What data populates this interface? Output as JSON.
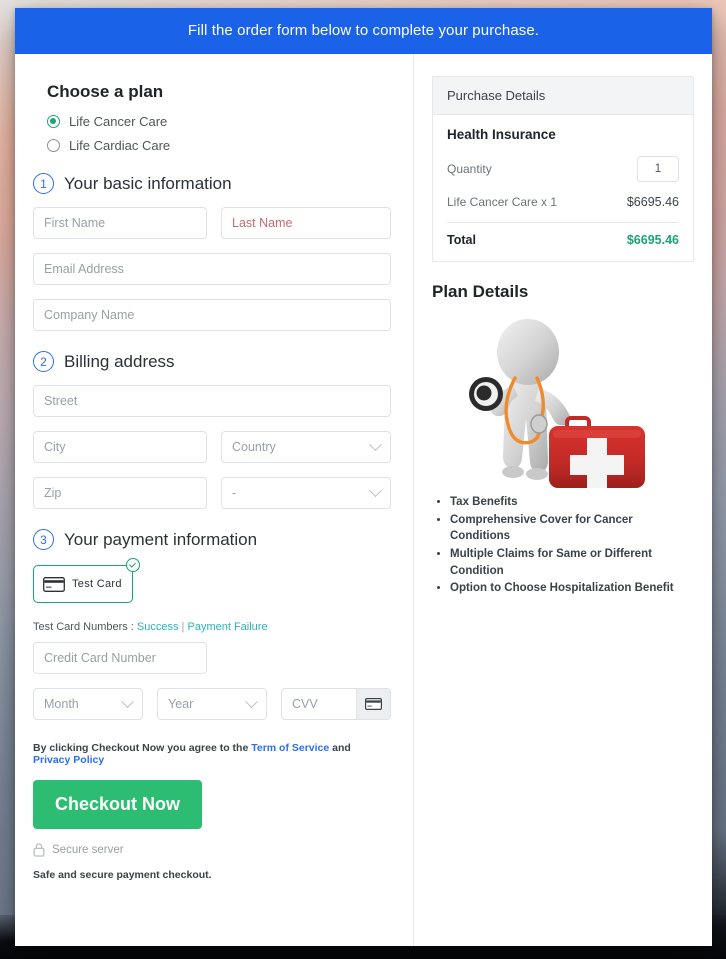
{
  "banner": {
    "text": "Fill the order form below to complete your purchase."
  },
  "plan": {
    "heading": "Choose a plan",
    "options": [
      {
        "label": "Life Cancer Care",
        "selected": true
      },
      {
        "label": "Life Cardiac Care",
        "selected": false
      }
    ]
  },
  "steps": {
    "basic": {
      "number": "1",
      "title": "Your basic information"
    },
    "billing": {
      "number": "2",
      "title": "Billing address"
    },
    "payment": {
      "number": "3",
      "title": "Your payment information"
    }
  },
  "basic_fields": {
    "first_name": "First Name",
    "last_name": "Last Name",
    "email": "Email Address",
    "company": "Company Name"
  },
  "billing_fields": {
    "street": "Street",
    "city": "City",
    "country": "Country",
    "zip": "Zip",
    "state": "-"
  },
  "payment": {
    "test_card_label": "Test Card",
    "test_numbers_prefix": "Test Card Numbers : ",
    "success_link": "Success",
    "separator": " | ",
    "failure_link": "Payment Failure",
    "card_number": "Credit Card Number",
    "month": "Month",
    "year": "Year",
    "cvv": "CVV"
  },
  "footer": {
    "terms_prefix": "By clicking Checkout Now you agree to the ",
    "terms_link": "Term of Service",
    "terms_mid": " and ",
    "privacy_link": "Privacy Policy",
    "checkout_label": "Checkout Now",
    "secure_server": "Secure server",
    "safe_note": "Safe and secure payment checkout."
  },
  "purchase": {
    "header": "Purchase Details",
    "product": "Health Insurance",
    "quantity_label": "Quantity",
    "quantity_value": "1",
    "line_item_label": "Life Cancer Care x 1",
    "line_item_amount": "$6695.46",
    "total_label": "Total",
    "total_amount": "$6695.46"
  },
  "plan_details": {
    "title": "Plan Details",
    "image_alt": "health-insurance-illustration",
    "bullets": [
      "Tax Benefits",
      "Comprehensive Cover for Cancer Conditions",
      "Multiple Claims for Same or Different Condition",
      "Option to Choose Hospitalization Benefit"
    ]
  },
  "colors": {
    "banner_blue": "#1a62e8",
    "accent_green": "#18a673",
    "button_green": "#2dbd72",
    "link_blue": "#2a6ff0",
    "link_teal": "#2bb3b9",
    "step_blue": "#2a6ff0"
  }
}
